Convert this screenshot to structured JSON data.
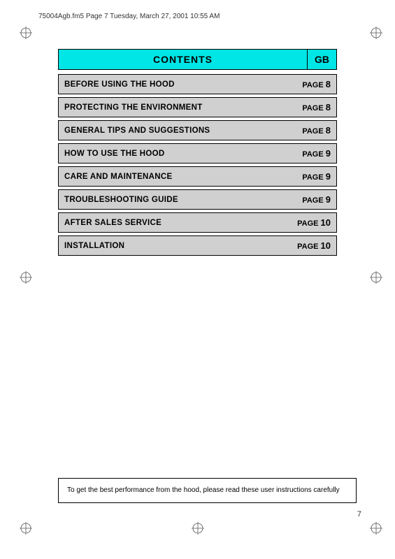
{
  "header": {
    "filename": "75004Agb.fm5  Page 7  Tuesday, March 27, 2001  10:55 AM"
  },
  "contents": {
    "title": "CONTENTS",
    "gb_label": "GB",
    "toc_items": [
      {
        "label": "BEFORE USING THE HOOD",
        "page_text": "PAGE",
        "page_num": "8"
      },
      {
        "label": "PROTECTING THE ENVIRONMENT",
        "page_text": "PAGE",
        "page_num": "8"
      },
      {
        "label": "GENERAL TIPS AND SUGGESTIONS",
        "page_text": "PAGE",
        "page_num": "8"
      },
      {
        "label": "HOW TO USE THE HOOD",
        "page_text": "PAGE",
        "page_num": "9"
      },
      {
        "label": "CARE AND MAINTENANCE",
        "page_text": "PAGE",
        "page_num": "9"
      },
      {
        "label": "TROUBLESHOOTING GUIDE",
        "page_text": "PAGE",
        "page_num": "9"
      },
      {
        "label": "AFTER SALES SERVICE",
        "page_text": "PAGE",
        "page_num": "10"
      },
      {
        "label": "INSTALLATION",
        "page_text": "PAGE",
        "page_num": "10"
      }
    ]
  },
  "bottom_note": "To get the best performance from the hood, please read these user instructions carefully",
  "page_number": "7"
}
